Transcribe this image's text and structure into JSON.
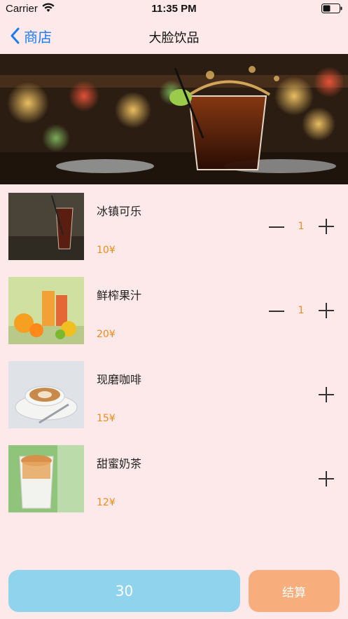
{
  "status_bar": {
    "carrier": "Carrier",
    "time": "11:35 PM",
    "icons": [
      "wifi-icon",
      "battery-icon"
    ]
  },
  "nav": {
    "back_label": "商店",
    "title": "大脸饮品",
    "back_icon": "chevron-left-icon"
  },
  "banner": {
    "image": "cola-glass-splash-banner"
  },
  "products": [
    {
      "name": "冰镇可乐",
      "price": "10¥",
      "quantity": "1",
      "image": "iced-cola-image"
    },
    {
      "name": "鲜榨果汁",
      "price": "20¥",
      "quantity": "1",
      "image": "fresh-juice-image"
    },
    {
      "name": "现磨咖啡",
      "price": "15¥",
      "quantity": "",
      "image": "coffee-image"
    },
    {
      "name": "甜蜜奶茶",
      "price": "12¥",
      "quantity": "",
      "image": "milk-tea-image"
    }
  ],
  "footer": {
    "total": "30",
    "checkout_label": "结算"
  },
  "colors": {
    "background": "#fde9e9",
    "accent_blue": "#1a7cf2",
    "price_orange": "#f08a1c",
    "total_button": "#8fd3ec",
    "checkout_button": "#f7ae7c"
  }
}
